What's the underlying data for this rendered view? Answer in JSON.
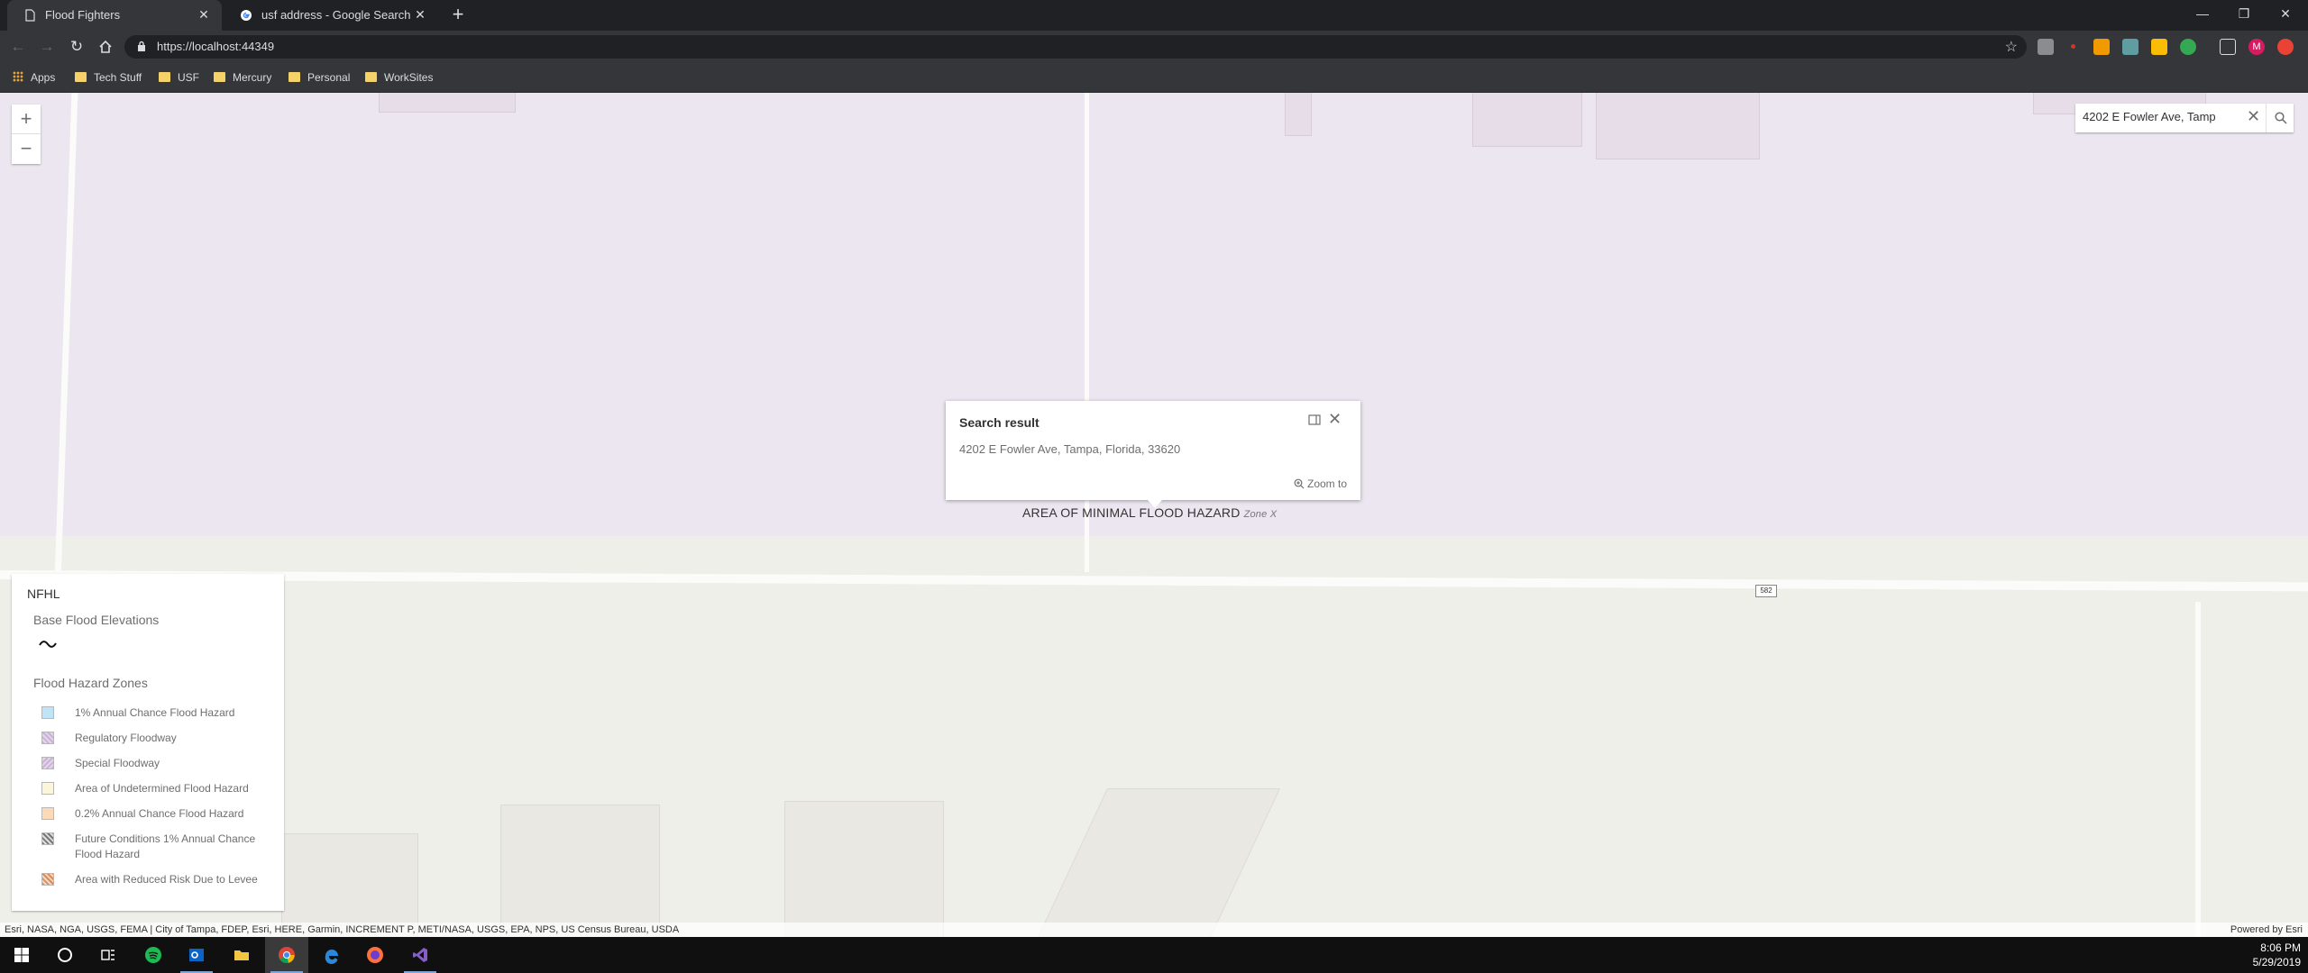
{
  "browser": {
    "tabs": [
      {
        "title": "Flood Fighters",
        "active": true,
        "icon": "page-icon"
      },
      {
        "title": "usf address - Google Search",
        "active": false,
        "icon": "google-icon"
      }
    ],
    "url": "https://localhost:44349",
    "bookmarks": [
      {
        "label": "Apps",
        "icon": "apps-grid-icon"
      },
      {
        "label": "Tech Stuff",
        "icon": "folder-icon"
      },
      {
        "label": "USF",
        "icon": "folder-icon"
      },
      {
        "label": "Mercury",
        "icon": "folder-icon"
      },
      {
        "label": "Personal",
        "icon": "folder-icon"
      },
      {
        "label": "WorkSites",
        "icon": "folder-icon"
      }
    ],
    "profile_initial": "M"
  },
  "map": {
    "zoom_in": "+",
    "zoom_out": "−",
    "search_value": "4202 E Fowler Ave, Tamp",
    "popup": {
      "title": "Search result",
      "body": "4202 E Fowler Ave, Tampa, Florida, 33620",
      "zoom_label": "Zoom to"
    },
    "zone_label": "AREA OF MINIMAL FLOOD HAZARD",
    "zone_sublabel": "Zone X",
    "road_shield": "582",
    "attribution": "Esri, NASA, NGA, USGS, FEMA | City of Tampa, FDEP, Esri, HERE, Garmin, INCREMENT P, METI/NASA, USGS, EPA, NPS, US Census Bureau, USDA",
    "powered_by": "Powered by Esri"
  },
  "legend": {
    "title": "NFHL",
    "base_flood_heading": "Base Flood Elevations",
    "hazard_heading": "Flood Hazard Zones",
    "items": [
      {
        "label": "1% Annual Chance Flood Hazard",
        "color": "#bfe3f7"
      },
      {
        "label": "Regulatory Floodway",
        "color": "#d8c4e0"
      },
      {
        "label": "Special Floodway",
        "color": "#d8c4e0"
      },
      {
        "label": "Area of Undetermined Flood Hazard",
        "color": "#fbf6d9"
      },
      {
        "label": "0.2% Annual Chance Flood Hazard",
        "color": "#fbd9b9"
      },
      {
        "label": "Future Conditions 1% Annual Chance Flood Hazard",
        "color": "#a0a0a0"
      },
      {
        "label": "Area with Reduced Risk Due to Levee",
        "color": "#e8b48a"
      }
    ]
  },
  "taskbar": {
    "time": "8:06 PM",
    "date": "5/29/2019"
  },
  "colors": {
    "zone_x": "#ebe6ef",
    "basemap": "#efefe9",
    "taskbar_accent": "#7aa7d8"
  }
}
